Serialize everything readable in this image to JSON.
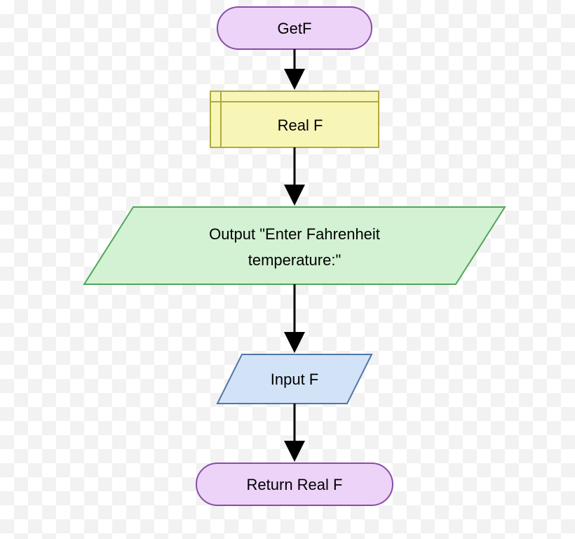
{
  "flowchart": {
    "nodes": {
      "start": {
        "label": "GetF",
        "type": "terminal"
      },
      "declare": {
        "label": "Real F",
        "type": "declaration"
      },
      "output": {
        "line1": "Output \"Enter Fahrenheit",
        "line2": "temperature:\"",
        "type": "io"
      },
      "input": {
        "label": "Input F",
        "type": "io"
      },
      "return": {
        "label": "Return Real F",
        "type": "terminal"
      }
    },
    "colors": {
      "terminal_fill": "#ecd3f7",
      "terminal_stroke": "#8a4ca8",
      "declare_fill": "#f8f6b7",
      "declare_stroke": "#b2a93f",
      "io_output_fill": "#d3f1d3",
      "io_output_stroke": "#4fa65a",
      "io_input_fill": "#d3e3f7",
      "io_input_stroke": "#4f77a6",
      "arrow": "#000000"
    }
  }
}
